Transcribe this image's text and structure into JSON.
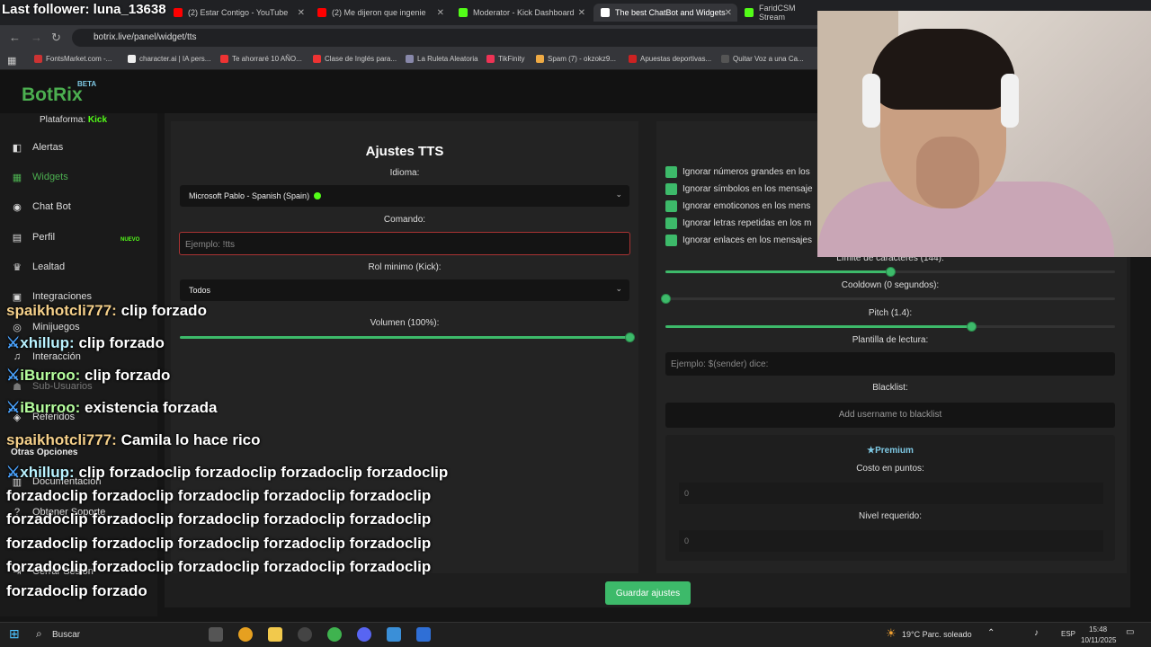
{
  "overlay": {
    "last_follower": "Last follower: luna_13638"
  },
  "browser": {
    "tabs": [
      {
        "label": "(2) Estar Contigo - YouTube",
        "color": "#ff0000"
      },
      {
        "label": "(2) Me dijeron que ingenie",
        "color": "#ff0000"
      },
      {
        "label": "Moderator - Kick Dashboard",
        "color": "#53fc18"
      },
      {
        "label": "The best ChatBot and Widgets",
        "color": "#ffffff"
      },
      {
        "label": "FaridCSM Stream",
        "color": "#53fc18"
      }
    ],
    "url": "botrix.live/panel/widget/tts",
    "bookmarks": [
      "FontsMarket.com -...",
      "character.ai | IA pers...",
      "Te ahorraré 10 AÑO...",
      "Clase de Inglés para...",
      "La Ruleta Aleatoria",
      "TikFinity",
      "Spam (7) - okzokz9...",
      "Apuestas deportivas...",
      "Quitar Voz a una Ca..."
    ]
  },
  "app": {
    "logo": "BotRix",
    "beta": "BETA",
    "platform_label": "Plataforma:",
    "platform_value": "Kick"
  },
  "sidebar": {
    "items": [
      {
        "label": "Alertas",
        "icon": "bell-icon",
        "glyph": "◧"
      },
      {
        "label": "Widgets",
        "icon": "widgets-icon",
        "glyph": "▦"
      },
      {
        "label": "Chat Bot",
        "icon": "robot-icon",
        "glyph": "◉"
      },
      {
        "label": "Perfil",
        "icon": "profile-card-icon",
        "glyph": "▤"
      },
      {
        "label": "Lealtad",
        "icon": "trophy-icon",
        "glyph": "♛"
      },
      {
        "label": "Integraciones",
        "icon": "integrations-icon",
        "glyph": "▣"
      },
      {
        "label": "Minijuegos",
        "icon": "gamepad-icon",
        "glyph": "◎"
      },
      {
        "label": "Interacción",
        "icon": "music-icon",
        "glyph": "♫"
      },
      {
        "label": "Sub-Usuarios",
        "icon": "users-icon",
        "glyph": "☗"
      },
      {
        "label": "Referidos",
        "icon": "referral-icon",
        "glyph": "◈"
      },
      {
        "label": "Documentación",
        "icon": "docs-icon",
        "glyph": "▥"
      },
      {
        "label": "Obtener Soporte",
        "icon": "support-icon",
        "glyph": "?"
      },
      {
        "label": "Cerrar Sesión",
        "icon": "logout-icon",
        "glyph": "⇥"
      }
    ],
    "nuevo": "NUEVO",
    "other_options": "Otras Opciones"
  },
  "tts": {
    "title": "Ajustes TTS",
    "idioma_label": "Idioma:",
    "idioma_value": "Microsoft Pablo - Spanish (Spain)",
    "comando_label": "Comando:",
    "comando_placeholder": "Ejemplo: !tts",
    "rol_label": "Rol minimo (Kick):",
    "rol_value": "Todos",
    "volumen_label": "Volumen (100%):",
    "volumen_level": 1.0,
    "checks": [
      "Ignorar números grandes en los",
      "Ignorar símbolos en los mensaje",
      "Ignorar emoticonos en los mens",
      "Ignorar letras repetidas en los m",
      "Ignorar enlaces en los mensajes"
    ],
    "limite_label": "Límite de caracteres (144):",
    "limite_level": 0.5,
    "cooldown_label": "Cooldown (0 segundos):",
    "cooldown_level": 0.0,
    "pitch_label": "Pitch (1.4):",
    "pitch_level": 0.68,
    "plantilla_label": "Plantilla de lectura:",
    "plantilla_placeholder": "Ejemplo: $(sender) dice:",
    "blacklist_label": "Blacklist:",
    "blacklist_placeholder": "Add username to blacklist",
    "premium_label": "Premium",
    "costo_label": "Costo en puntos:",
    "costo_value": "0",
    "nivel_label": "Nivel requerido:",
    "nivel_value": "0",
    "save_label": "Guardar ajustes"
  },
  "chat": [
    {
      "user": "spaikhotcli777:",
      "msg": "clip forzado",
      "badge": false,
      "ucolor": "u1"
    },
    {
      "user": "xhillup:",
      "msg": "clip forzado",
      "badge": true,
      "ucolor": "u2"
    },
    {
      "user": "iBurroo:",
      "msg": "clip forzado",
      "badge": true,
      "ucolor": "u3"
    },
    {
      "user": "iBurroo:",
      "msg": "existencia forzada",
      "badge": true,
      "ucolor": "u3"
    },
    {
      "user": "spaikhotcli777:",
      "msg": "Camila lo hace rico",
      "badge": false,
      "ucolor": "u1"
    },
    {
      "user": "xhillup:",
      "msg": "clip forzadoclip forzadoclip forzadoclip forzadoclip",
      "badge": true,
      "ucolor": "u2"
    },
    {
      "user": "",
      "msg": "forzadoclip forzadoclip forzadoclip forzadoclip forzadoclip",
      "badge": false,
      "ucolor": "u2"
    },
    {
      "user": "",
      "msg": "forzadoclip forzadoclip forzadoclip forzadoclip forzadoclip",
      "badge": false,
      "ucolor": "u2"
    },
    {
      "user": "",
      "msg": "forzadoclip forzadoclip forzadoclip forzadoclip forzadoclip",
      "badge": false,
      "ucolor": "u2"
    },
    {
      "user": "",
      "msg": "forzadoclip forzadoclip forzadoclip forzadoclip forzadoclip",
      "badge": false,
      "ucolor": "u2"
    },
    {
      "user": "",
      "msg": "forzadoclip forzado",
      "badge": false,
      "ucolor": "u2"
    }
  ],
  "taskbar": {
    "search": "Buscar",
    "weather": "19°C  Parc. soleado",
    "lang": "ESP",
    "time": "15:48",
    "date": "10/11/2025"
  }
}
